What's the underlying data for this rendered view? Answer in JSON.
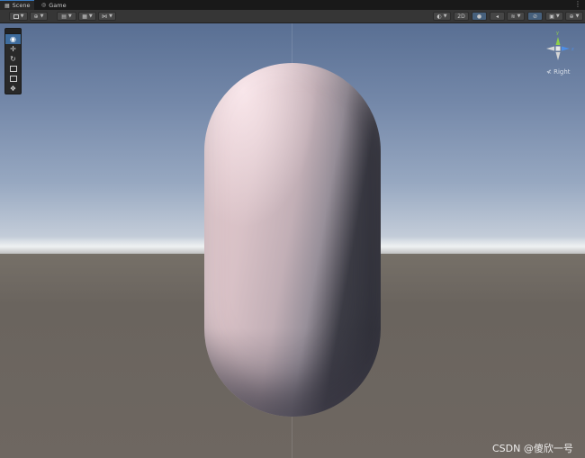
{
  "tabs": [
    {
      "label": "Scene",
      "icon": "grid-icon",
      "active": true
    },
    {
      "label": "Game",
      "icon": "gamepad-icon",
      "active": false
    }
  ],
  "toolbar": {
    "view_2d_label": "2D",
    "accent_color": "#3e6c9d"
  },
  "tools": [
    {
      "name": "view-tool",
      "icon": "eye-icon",
      "active": true
    },
    {
      "name": "move-tool",
      "icon": "move-arrows-icon",
      "active": false
    },
    {
      "name": "rotate-tool",
      "icon": "rotate-icon",
      "active": false
    },
    {
      "name": "scale-tool",
      "icon": "scale-icon",
      "active": false
    },
    {
      "name": "rect-tool",
      "icon": "rect-icon",
      "active": false
    },
    {
      "name": "transform-tool",
      "icon": "transform-icon",
      "active": false
    }
  ],
  "gizmo": {
    "axis_y": "y",
    "axis_z": "z",
    "view_label": "Right"
  },
  "watermark": "CSDN @傻欣一号"
}
